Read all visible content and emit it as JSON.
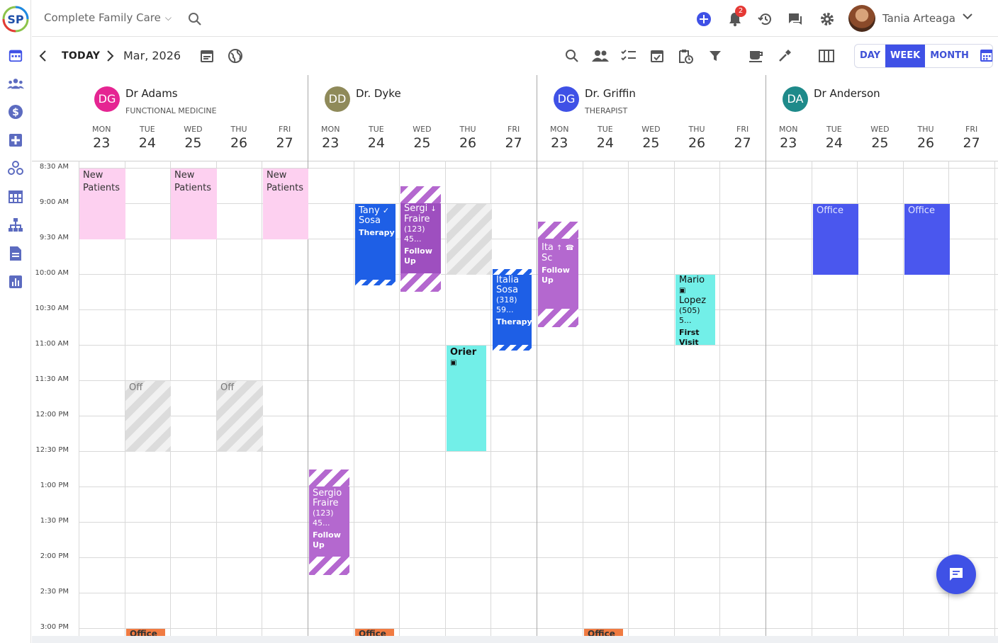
{
  "topbar": {
    "practice": "Complete Family Care",
    "notification_count": "2",
    "user_name": "Tania Arteaga",
    "icons": [
      "add-icon",
      "bell-icon",
      "history-icon",
      "chat-icon",
      "gear-icon",
      "chevron-down-icon"
    ]
  },
  "rail": {
    "icons": [
      "calendar-icon",
      "patients-icon",
      "billing-icon",
      "clinical-icon",
      "network-icon",
      "table-icon",
      "org-chart-icon",
      "document-icon",
      "reports-icon"
    ]
  },
  "toolbar": {
    "today": "TODAY",
    "month": "Mar, 2026",
    "views": [
      "DAY",
      "WEEK",
      "MONTH"
    ],
    "active_view": "WEEK"
  },
  "providers": [
    {
      "initials": "DG",
      "name": "Dr Adams",
      "specialty": "FUNCTIONAL MEDICINE",
      "color": "#e52592"
    },
    {
      "initials": "DD",
      "name": "Dr. Dyke",
      "specialty": "",
      "color": "#8f8a5a"
    },
    {
      "initials": "DG",
      "name": "Dr. Griffin",
      "specialty": "THERAPIST",
      "color": "#3f51e6"
    },
    {
      "initials": "DA",
      "name": "Dr Anderson",
      "specialty": "",
      "color": "#1e8a8a"
    }
  ],
  "days": [
    {
      "dow": "MON",
      "date": "23"
    },
    {
      "dow": "TUE",
      "date": "24"
    },
    {
      "dow": "WED",
      "date": "25"
    },
    {
      "dow": "THU",
      "date": "26"
    },
    {
      "dow": "FRI",
      "date": "27"
    }
  ],
  "times": [
    "8:30 AM",
    "9:00 AM",
    "9:30 AM",
    "10:00 AM",
    "10:30 AM",
    "11:00 AM",
    "11:30 AM",
    "12:00 PM",
    "12:30 PM",
    "1:00 PM",
    "1:30 PM",
    "2:00 PM",
    "2:30 PM",
    "3:00 PM"
  ],
  "events": {
    "adams_mon": {
      "line1": "New",
      "line2": "Patients"
    },
    "adams_wed": {
      "line1": "New",
      "line2": "Patients"
    },
    "adams_fri": {
      "line1": "New",
      "line2": "Patients"
    },
    "adams_tue_off": "Off",
    "adams_thu_off": "Off",
    "adams_tue_office": "Office",
    "dyke_mon": {
      "name1": "Sergio",
      "name2": "Fraire",
      "phone": "(123) 45...",
      "type": "Follow Up"
    },
    "dyke_tue": {
      "name1": "Tany",
      "name2": "Sosa",
      "type": "Therapy"
    },
    "dyke_wed": {
      "name1": "Sergi",
      "name2": "Fraire",
      "phone": "(123) 45...",
      "type": "Follow Up"
    },
    "dyke_thu": {
      "name1": "Orier"
    },
    "dyke_fri": {
      "name1": "Italia",
      "name2": "Sosa",
      "phone": "(318) 59...",
      "type": "Therapy"
    },
    "dyke_tue_office": "Office",
    "griffin_mon": {
      "name1": "Ita",
      "name2": "Sc",
      "type": "Follow Up"
    },
    "griffin_thu": {
      "name1": "Mario",
      "name2": "Lopez",
      "phone": "(505) 5...",
      "type": "First Visit"
    },
    "griffin_tue_office": "Office",
    "anderson_tue": "Office",
    "anderson_thu": "Office"
  }
}
